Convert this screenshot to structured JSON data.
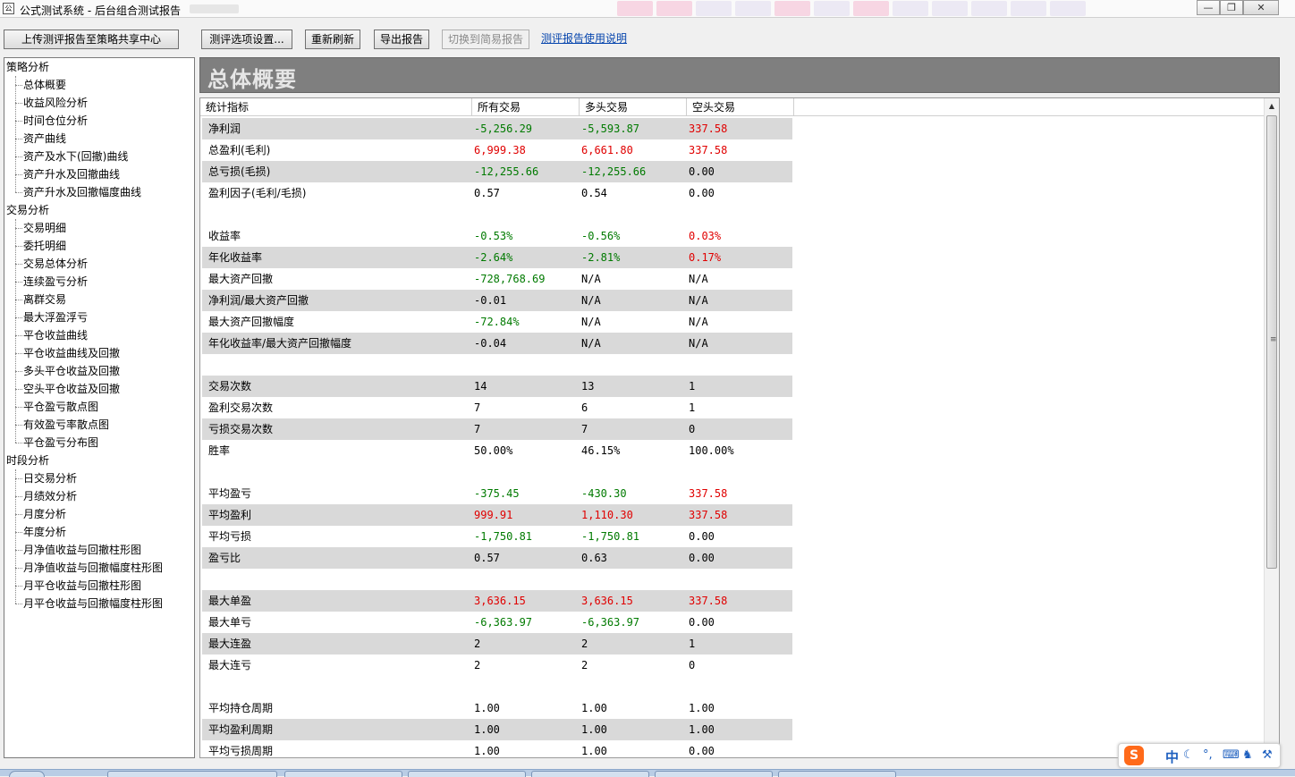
{
  "window": {
    "title": "公式测试系统 - 后台组合测试报告",
    "icon_text": "公",
    "controls": [
      "minimize-icon",
      "restore-icon",
      "close-icon"
    ]
  },
  "toolbar": {
    "upload_label": "上传测评报告至策略共享中心",
    "options_label": "测评选项设置...",
    "refresh_label": "重新刷新",
    "export_label": "导出报告",
    "switch_label": "切换到简易报告",
    "help_link": "测评报告使用说明"
  },
  "tree": {
    "groups": [
      {
        "label": "策略分析",
        "items": [
          "总体概要",
          "收益风险分析",
          "时间仓位分析",
          "资产曲线",
          "资产及水下(回撤)曲线",
          "资产升水及回撤曲线",
          "资产升水及回撤幅度曲线"
        ]
      },
      {
        "label": "交易分析",
        "items": [
          "交易明细",
          "委托明细",
          "交易总体分析",
          "连续盈亏分析",
          "离群交易",
          "最大浮盈浮亏",
          "平仓收益曲线",
          "平仓收益曲线及回撤",
          "多头平仓收益及回撤",
          "空头平仓收益及回撤",
          "平仓盈亏散点图",
          "有效盈亏率散点图",
          "平仓盈亏分布图"
        ]
      },
      {
        "label": "时段分析",
        "items": [
          "日交易分析",
          "月绩效分析",
          "月度分析",
          "年度分析",
          "月净值收益与回撤柱形图",
          "月净值收益与回撤幅度柱形图",
          "月平仓收益与回撤柱形图",
          "月平仓收益与回撤幅度柱形图"
        ]
      }
    ]
  },
  "report": {
    "title": "总体概要",
    "columns": [
      "统计指标",
      "所有交易",
      "多头交易",
      "空头交易"
    ],
    "rows": [
      {
        "label": "净利润",
        "all": "-5,256.29",
        "long": "-5,593.87",
        "short": "337.58",
        "colors": [
          "green",
          "green",
          "red"
        ]
      },
      {
        "label": "总盈利(毛利)",
        "all": "6,999.38",
        "long": "6,661.80",
        "short": "337.58",
        "colors": [
          "red",
          "red",
          "red"
        ]
      },
      {
        "label": "总亏损(毛损)",
        "all": "-12,255.66",
        "long": "-12,255.66",
        "short": "0.00",
        "colors": [
          "green",
          "green",
          "black"
        ]
      },
      {
        "label": "盈利因子(毛利/毛损)",
        "all": "0.57",
        "long": "0.54",
        "short": "0.00",
        "colors": [
          "black",
          "black",
          "black"
        ]
      },
      {
        "label": "收益率",
        "all": "-0.53%",
        "long": "-0.56%",
        "short": "0.03%",
        "colors": [
          "green",
          "green",
          "red"
        ]
      },
      {
        "label": "年化收益率",
        "all": "-2.64%",
        "long": "-2.81%",
        "short": "0.17%",
        "colors": [
          "green",
          "green",
          "red"
        ]
      },
      {
        "label": "最大资产回撤",
        "all": "-728,768.69",
        "long": "N/A",
        "short": "N/A",
        "colors": [
          "green",
          "black",
          "black"
        ]
      },
      {
        "label": "净利润/最大资产回撤",
        "all": "-0.01",
        "long": "N/A",
        "short": "N/A",
        "colors": [
          "black",
          "black",
          "black"
        ]
      },
      {
        "label": "最大资产回撤幅度",
        "all": "-72.84%",
        "long": "N/A",
        "short": "N/A",
        "colors": [
          "green",
          "black",
          "black"
        ]
      },
      {
        "label": "年化收益率/最大资产回撤幅度",
        "all": "-0.04",
        "long": "N/A",
        "short": "N/A",
        "colors": [
          "black",
          "black",
          "black"
        ]
      },
      {
        "label": "交易次数",
        "all": "14",
        "long": "13",
        "short": "1",
        "colors": [
          "black",
          "black",
          "black"
        ]
      },
      {
        "label": "盈利交易次数",
        "all": "7",
        "long": "6",
        "short": "1",
        "colors": [
          "black",
          "black",
          "black"
        ]
      },
      {
        "label": "亏损交易次数",
        "all": "7",
        "long": "7",
        "short": "0",
        "colors": [
          "black",
          "black",
          "black"
        ]
      },
      {
        "label": "胜率",
        "all": "50.00%",
        "long": "46.15%",
        "short": "100.00%",
        "colors": [
          "black",
          "black",
          "black"
        ]
      },
      {
        "label": "平均盈亏",
        "all": "-375.45",
        "long": "-430.30",
        "short": "337.58",
        "colors": [
          "green",
          "green",
          "red"
        ]
      },
      {
        "label": "平均盈利",
        "all": "999.91",
        "long": "1,110.30",
        "short": "337.58",
        "colors": [
          "red",
          "red",
          "red"
        ]
      },
      {
        "label": "平均亏损",
        "all": "-1,750.81",
        "long": "-1,750.81",
        "short": "0.00",
        "colors": [
          "green",
          "green",
          "black"
        ]
      },
      {
        "label": "盈亏比",
        "all": "0.57",
        "long": "0.63",
        "short": "0.00",
        "colors": [
          "black",
          "black",
          "black"
        ]
      },
      {
        "label": "最大单盈",
        "all": "3,636.15",
        "long": "3,636.15",
        "short": "337.58",
        "colors": [
          "red",
          "red",
          "red"
        ]
      },
      {
        "label": "最大单亏",
        "all": "-6,363.97",
        "long": "-6,363.97",
        "short": "0.00",
        "colors": [
          "green",
          "green",
          "black"
        ]
      },
      {
        "label": "最大连盈",
        "all": "2",
        "long": "2",
        "short": "1",
        "colors": [
          "black",
          "black",
          "black"
        ]
      },
      {
        "label": "最大连亏",
        "all": "2",
        "long": "2",
        "short": "0",
        "colors": [
          "black",
          "black",
          "black"
        ]
      },
      {
        "label": "平均持仓周期",
        "all": "1.00",
        "long": "1.00",
        "short": "1.00",
        "colors": [
          "black",
          "black",
          "black"
        ]
      },
      {
        "label": "平均盈利周期",
        "all": "1.00",
        "long": "1.00",
        "short": "1.00",
        "colors": [
          "black",
          "black",
          "black"
        ]
      },
      {
        "label": "平均亏损周期",
        "all": "1.00",
        "long": "1.00",
        "short": "0.00",
        "colors": [
          "black",
          "black",
          "black"
        ]
      }
    ]
  },
  "ime": {
    "logo": "S",
    "mode": "中",
    "icons": [
      "moon-icon",
      "punctuation-icon",
      "keyboard-icon",
      "wrench-icon"
    ]
  },
  "colors": {
    "positive": "#e00000",
    "negative": "#007a00",
    "header_band": "#7f7f7f",
    "row_shade": "#d9d9d9",
    "link": "#0645ad"
  }
}
